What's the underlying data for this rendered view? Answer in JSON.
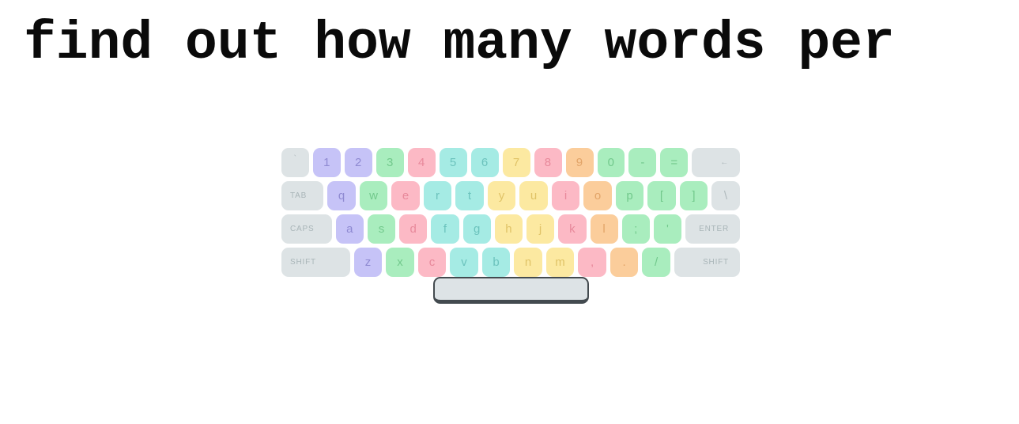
{
  "prompt": {
    "text": "find out how many words per"
  },
  "keyboard": {
    "highlighted_key": "space",
    "colors": {
      "gray": "#dde3e5",
      "purple": "#c6c3f7",
      "green": "#a9edbe",
      "pink": "#fcb9c5",
      "cyan": "#a5ebe4",
      "yellow": "#fce9a1",
      "orange": "#fbcd9b",
      "highlight_border": "#434a4f",
      "background": "#ffffff",
      "prompt_text": "#0a0a0a"
    },
    "rows": [
      {
        "name": "number-row",
        "keys": [
          {
            "label": "`",
            "name": "backtick",
            "color": "gray",
            "size": "w-tilde"
          },
          {
            "label": "1",
            "name": "1",
            "color": "purple",
            "size": ""
          },
          {
            "label": "2",
            "name": "2",
            "color": "purple",
            "size": ""
          },
          {
            "label": "3",
            "name": "3",
            "color": "green",
            "size": ""
          },
          {
            "label": "4",
            "name": "4",
            "color": "pink",
            "size": ""
          },
          {
            "label": "5",
            "name": "5",
            "color": "cyan",
            "size": ""
          },
          {
            "label": "6",
            "name": "6",
            "color": "cyan",
            "size": ""
          },
          {
            "label": "7",
            "name": "7",
            "color": "yellow",
            "size": ""
          },
          {
            "label": "8",
            "name": "8",
            "color": "pink",
            "size": ""
          },
          {
            "label": "9",
            "name": "9",
            "color": "orange",
            "size": ""
          },
          {
            "label": "0",
            "name": "0",
            "color": "green",
            "size": ""
          },
          {
            "label": "-",
            "name": "minus",
            "color": "green",
            "size": ""
          },
          {
            "label": "=",
            "name": "equals",
            "color": "green",
            "size": ""
          },
          {
            "label": "←",
            "name": "backspace",
            "color": "gray",
            "size": "w-back",
            "mod": true,
            "align": "right"
          }
        ]
      },
      {
        "name": "top-letter-row",
        "keys": [
          {
            "label": "TAB",
            "name": "tab",
            "color": "gray",
            "size": "w-tab",
            "mod": true,
            "align": "left"
          },
          {
            "label": "q",
            "name": "q",
            "color": "purple",
            "size": ""
          },
          {
            "label": "w",
            "name": "w",
            "color": "green",
            "size": ""
          },
          {
            "label": "e",
            "name": "e",
            "color": "pink",
            "size": ""
          },
          {
            "label": "r",
            "name": "r",
            "color": "cyan",
            "size": ""
          },
          {
            "label": "t",
            "name": "t",
            "color": "cyan",
            "size": ""
          },
          {
            "label": "y",
            "name": "y",
            "color": "yellow",
            "size": ""
          },
          {
            "label": "u",
            "name": "u",
            "color": "yellow",
            "size": ""
          },
          {
            "label": "i",
            "name": "i",
            "color": "pink",
            "size": ""
          },
          {
            "label": "o",
            "name": "o",
            "color": "orange",
            "size": ""
          },
          {
            "label": "p",
            "name": "p",
            "color": "green",
            "size": ""
          },
          {
            "label": "[",
            "name": "bracket-left",
            "color": "green",
            "size": ""
          },
          {
            "label": "]",
            "name": "bracket-right",
            "color": "green",
            "size": ""
          },
          {
            "label": "\\",
            "name": "backslash",
            "color": "gray",
            "size": "w-backslash"
          }
        ]
      },
      {
        "name": "home-row",
        "keys": [
          {
            "label": "CAPS",
            "name": "caps-lock",
            "color": "gray",
            "size": "w-caps",
            "mod": true,
            "align": "left"
          },
          {
            "label": "a",
            "name": "a",
            "color": "purple",
            "size": ""
          },
          {
            "label": "s",
            "name": "s",
            "color": "green",
            "size": ""
          },
          {
            "label": "d",
            "name": "d",
            "color": "pink",
            "size": ""
          },
          {
            "label": "f",
            "name": "f",
            "color": "cyan",
            "size": ""
          },
          {
            "label": "g",
            "name": "g",
            "color": "cyan",
            "size": ""
          },
          {
            "label": "h",
            "name": "h",
            "color": "yellow",
            "size": ""
          },
          {
            "label": "j",
            "name": "j",
            "color": "yellow",
            "size": ""
          },
          {
            "label": "k",
            "name": "k",
            "color": "pink",
            "size": ""
          },
          {
            "label": "l",
            "name": "l",
            "color": "orange",
            "size": ""
          },
          {
            "label": ";",
            "name": "semicolon",
            "color": "green",
            "size": ""
          },
          {
            "label": "'",
            "name": "apostrophe",
            "color": "green",
            "size": ""
          },
          {
            "label": "ENTER",
            "name": "enter",
            "color": "gray",
            "size": "w-enter",
            "mod": true,
            "align": "right"
          }
        ]
      },
      {
        "name": "bottom-letter-row",
        "keys": [
          {
            "label": "SHIFT",
            "name": "shift-left",
            "color": "gray",
            "size": "w-shift-l",
            "mod": true,
            "align": "left"
          },
          {
            "label": "z",
            "name": "z",
            "color": "purple",
            "size": ""
          },
          {
            "label": "x",
            "name": "x",
            "color": "green",
            "size": ""
          },
          {
            "label": "c",
            "name": "c",
            "color": "pink",
            "size": ""
          },
          {
            "label": "v",
            "name": "v",
            "color": "cyan",
            "size": ""
          },
          {
            "label": "b",
            "name": "b",
            "color": "cyan",
            "size": ""
          },
          {
            "label": "n",
            "name": "n",
            "color": "yellow",
            "size": ""
          },
          {
            "label": "m",
            "name": "m",
            "color": "yellow",
            "size": ""
          },
          {
            "label": ",",
            "name": "comma",
            "color": "pink",
            "size": ""
          },
          {
            "label": ".",
            "name": "period",
            "color": "orange",
            "size": ""
          },
          {
            "label": "/",
            "name": "slash",
            "color": "green",
            "size": ""
          },
          {
            "label": "SHIFT",
            "name": "shift-right",
            "color": "gray",
            "size": "w-shift-r",
            "mod": true,
            "align": "right"
          }
        ]
      }
    ],
    "space_key": {
      "label": "",
      "name": "space"
    }
  }
}
